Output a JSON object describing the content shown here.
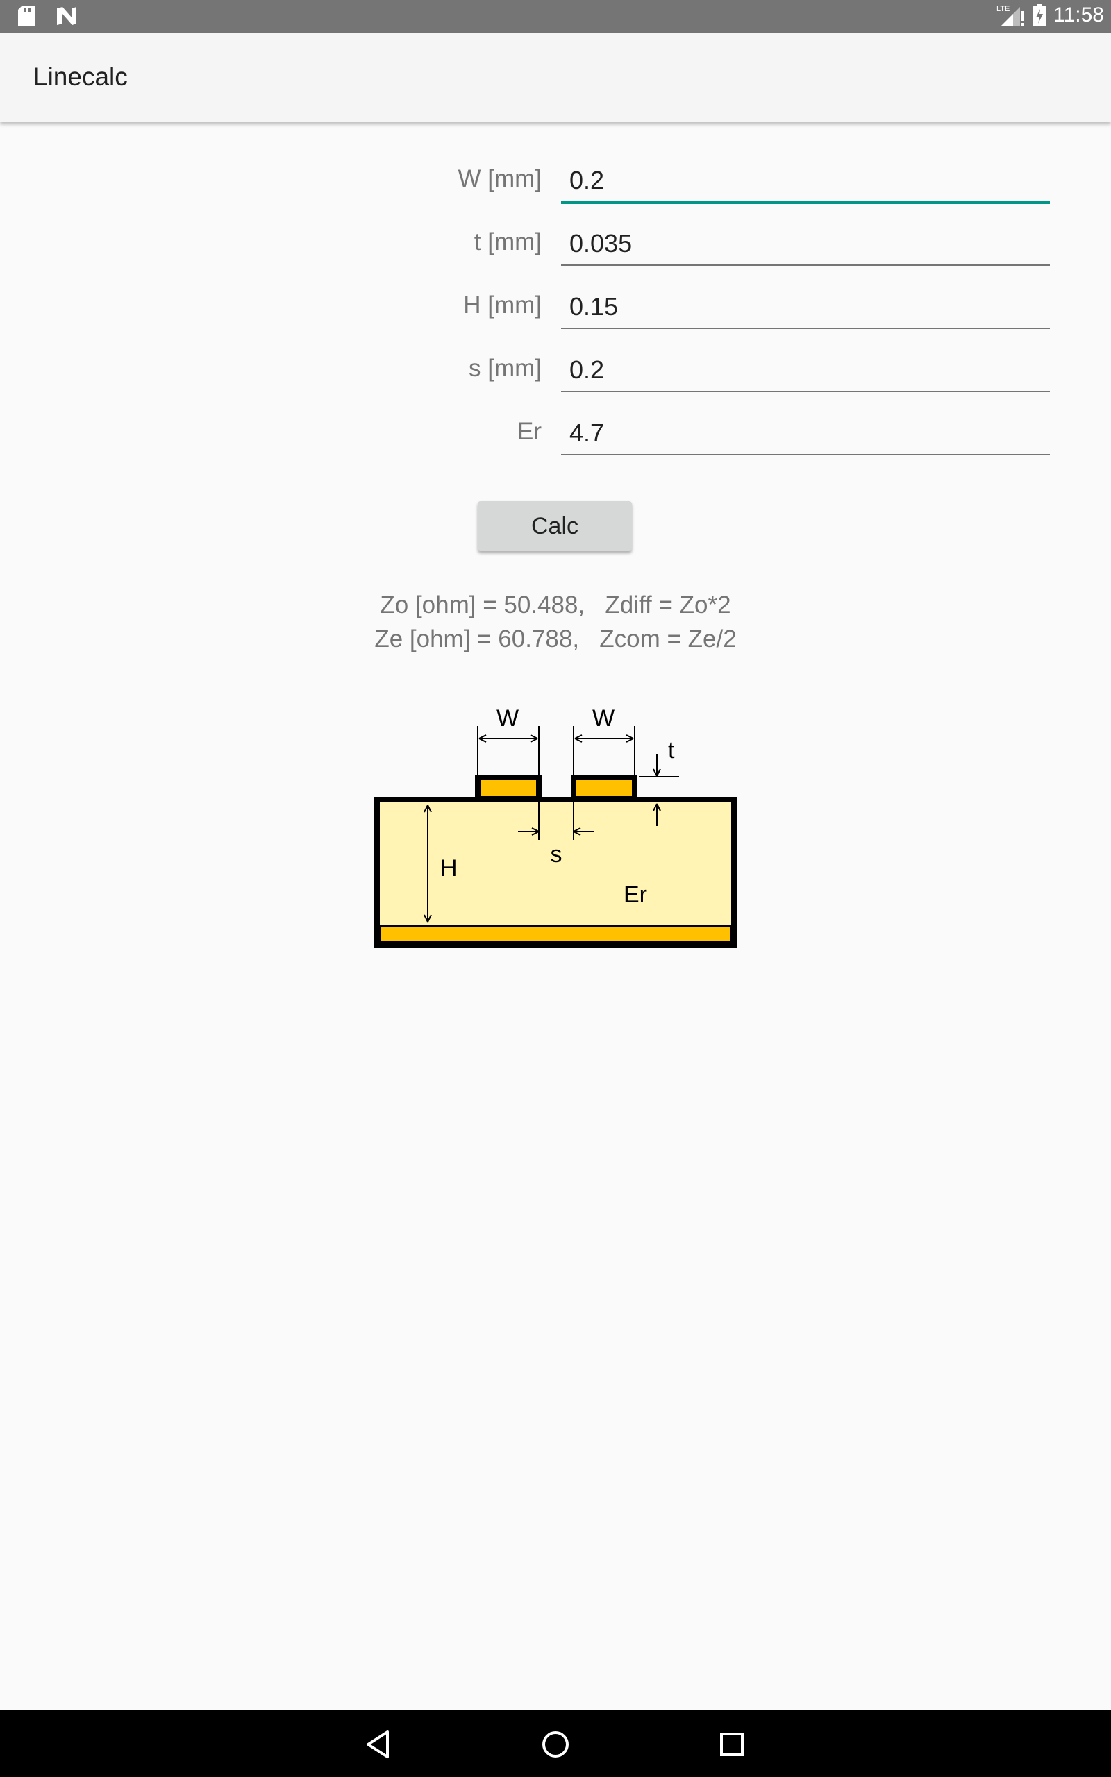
{
  "status_bar": {
    "time": "11:58",
    "icons_left": [
      "sd-card-icon",
      "n-notification-icon"
    ],
    "icons_right": [
      "lte-signal-icon",
      "battery-charging-icon"
    ]
  },
  "app_bar": {
    "title": "Linecalc"
  },
  "form": {
    "fields": [
      {
        "label": "W [mm]",
        "value": "0.2",
        "focused": true
      },
      {
        "label": "t [mm]",
        "value": "0.035"
      },
      {
        "label": "H [mm]",
        "value": "0.15"
      },
      {
        "label": "s [mm]",
        "value": "0.2"
      },
      {
        "label": "Er",
        "value": "4.7"
      }
    ],
    "calc_label": "Calc"
  },
  "results": {
    "line1": "Zo [ohm] = 50.488,   Zdiff = Zo*2",
    "line2": "Ze [ohm] = 60.788,   Zcom = Ze/2"
  },
  "diagram": {
    "labels": {
      "w1": "W",
      "w2": "W",
      "t": "t",
      "h": "H",
      "s": "s",
      "er": "Er"
    },
    "colors": {
      "substrate": "#fff4b3",
      "copper": "#ffc000",
      "outline": "#000000"
    }
  },
  "nav_bar": {
    "buttons": [
      "back-icon",
      "home-icon",
      "recents-icon"
    ]
  }
}
